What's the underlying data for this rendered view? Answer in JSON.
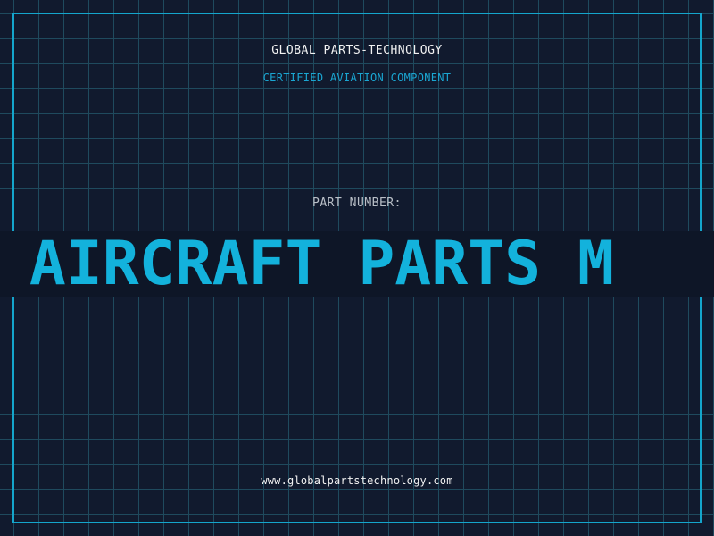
{
  "header": {
    "brand": "GLOBAL PARTS-TECHNOLOGY",
    "tagline": "CERTIFIED AVIATION COMPONENT"
  },
  "part": {
    "label": "PART NUMBER:",
    "marquee_text": "O AIRCRAFT PARTS M"
  },
  "footer": {
    "website": "www.globalpartstechnology.com"
  },
  "colors": {
    "background": "#111a2e",
    "grid": "#1f4a5e",
    "accent": "#14a5cc",
    "band": "#0e1627",
    "text_light": "#f2f2f2",
    "text_muted": "#b9bfc7"
  }
}
